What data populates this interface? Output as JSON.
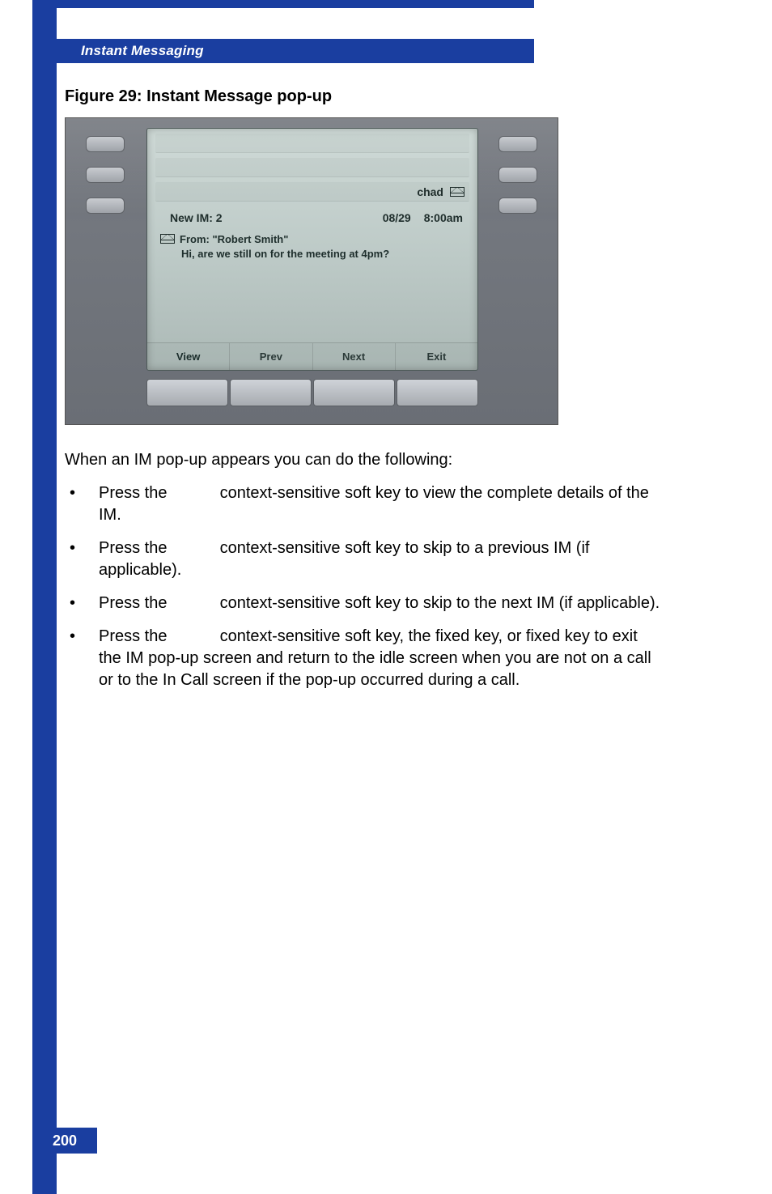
{
  "section_title": "Instant Messaging",
  "figure_caption": "Figure 29: Instant Message pop-up",
  "phone_screen": {
    "user": "chad",
    "header": {
      "left": "New IM: 2",
      "date": "08/29",
      "time": "8:00am"
    },
    "message": {
      "from_label": "From: \"Robert Smith\"",
      "body": "Hi, are we still on for the meeting at 4pm?"
    },
    "softkeys": [
      "View",
      "Prev",
      "Next",
      "Exit"
    ]
  },
  "intro": "When an IM pop-up appears you can do the following:",
  "bullets": [
    {
      "prefix": "Press the ",
      "key": "",
      "rest": " context-sensitive soft key to view the complete details of the IM."
    },
    {
      "prefix": "Press the ",
      "key": "",
      "rest": " context-sensitive soft key to skip to a previous IM (if applicable)."
    },
    {
      "prefix": "Press the ",
      "key": "",
      "rest": " context-sensitive soft key to skip to the next IM (if applicable)."
    },
    {
      "prefix": "Press the ",
      "key": "",
      "rest": " context-sensitive soft key, the              fixed key, or          fixed key to exit the IM pop-up screen and return to the idle screen when you are not on a call or to the In Call screen if the pop-up occurred during a call."
    }
  ],
  "page_number": "200"
}
